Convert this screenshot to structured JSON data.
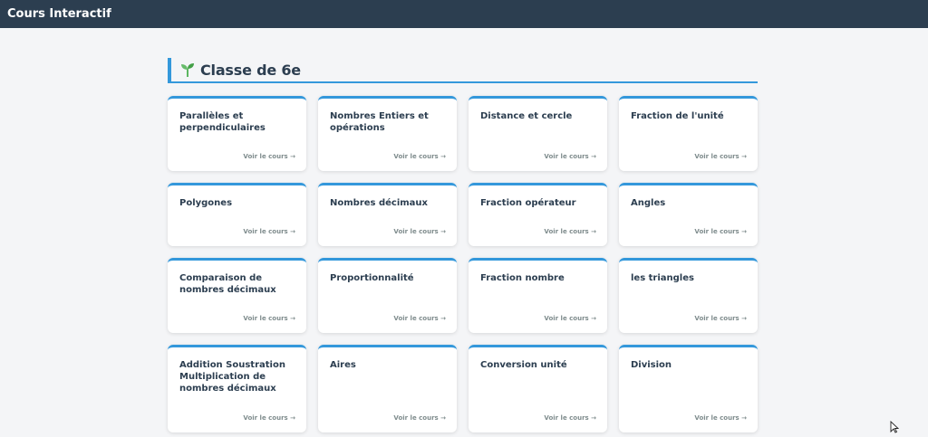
{
  "app": {
    "title": "Cours Interactif"
  },
  "section": {
    "title": "Classe de 6e",
    "icon": "sprout-icon"
  },
  "link_label": "Voir le cours →",
  "cards": [
    {
      "title": "Parallèles et perpendiculaires",
      "link": "Voir le cours →"
    },
    {
      "title": "Nombres Entiers et opérations",
      "link": "Voir le cours →"
    },
    {
      "title": "Distance et cercle",
      "link": "Voir le cours →"
    },
    {
      "title": "Fraction de l'unité",
      "link": "Voir le cours →"
    },
    {
      "title": "Polygones",
      "link": "Voir le cours →"
    },
    {
      "title": "Nombres décimaux",
      "link": "Voir le cours →"
    },
    {
      "title": "Fraction opérateur",
      "link": "Voir le cours →"
    },
    {
      "title": "Angles",
      "link": "Voir le cours →"
    },
    {
      "title": "Comparaison de nombres décimaux",
      "link": "Voir le cours →"
    },
    {
      "title": "Proportionnalité",
      "link": "Voir le cours →"
    },
    {
      "title": "Fraction nombre",
      "link": "Voir le cours →"
    },
    {
      "title": "les triangles",
      "link": "Voir le cours →"
    },
    {
      "title": "Addition Soustration Multiplication de nombres décimaux",
      "link": "Voir le cours →"
    },
    {
      "title": "Aires",
      "link": "Voir le cours →"
    },
    {
      "title": "Conversion unité",
      "link": "Voir le cours →"
    },
    {
      "title": "Division",
      "link": "Voir le cours →"
    }
  ],
  "colors": {
    "topbar": "#2c3e50",
    "accent": "#3498db",
    "text": "#2c3e50",
    "muted": "#7f8c8d",
    "sprout": "#4caf50"
  }
}
